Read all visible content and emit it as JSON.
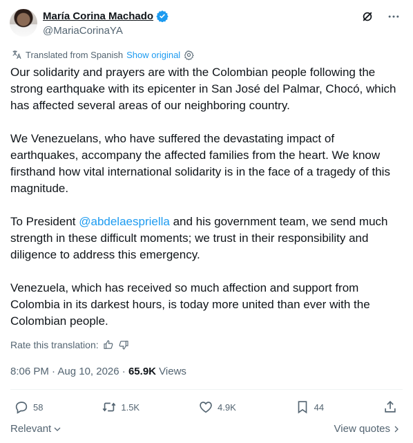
{
  "author": {
    "name": "María Corina Machado",
    "handle": "@MariaCorinaYA"
  },
  "translation": {
    "label": "Translated from Spanish",
    "show_original": "Show original"
  },
  "post": {
    "p1": "Our solidarity and prayers are with the Colombian people following the strong earthquake with its epicenter in San José del Palmar, Chocó, which has affected several areas of our neighboring country.",
    "p2": "We Venezuelans, who have suffered the devastating impact of earthquakes, accompany the affected families from the heart. We know firsthand how vital international solidarity is in the face of a tragedy of this magnitude.",
    "p3_before": "To President ",
    "p3_mention": "@abdelaespriella",
    "p3_after": " and his government team, we send much strength in these difficult moments; we trust in their responsibility and diligence to address this emergency.",
    "p4": "Venezuela, which has received so much affection and support from Colombia in its darkest hours, is today more united than ever with the Colombian people."
  },
  "rate": {
    "label": "Rate this translation:"
  },
  "meta": {
    "time": "8:06 PM · Aug 10, 2026",
    "separator": " · ",
    "views_count": "65.9K",
    "views_label": " Views"
  },
  "actions": {
    "replies": "58",
    "reposts": "1.5K",
    "likes": "4.9K",
    "bookmarks": "44"
  },
  "footer": {
    "sort": "Relevant",
    "view_quotes": "View quotes"
  },
  "colors": {
    "text": "#0f1419",
    "secondary": "#536471",
    "link": "#1d9bf0",
    "border": "#eff3f4"
  }
}
